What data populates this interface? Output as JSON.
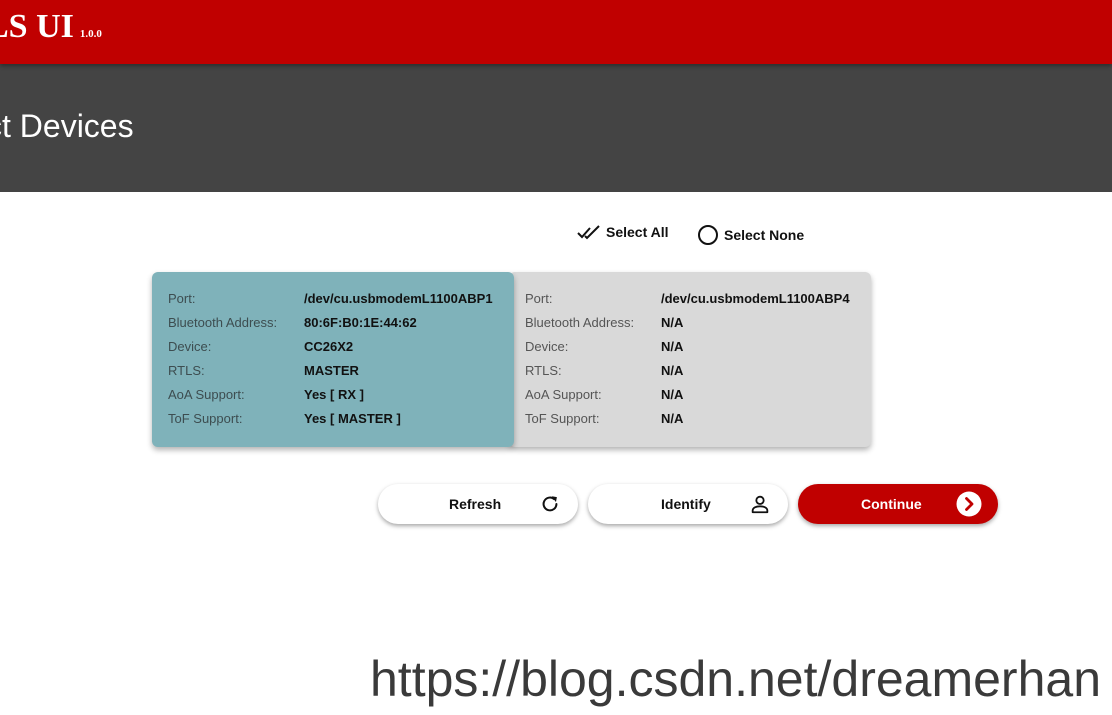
{
  "app": {
    "title": "LS UI",
    "version": "1.0.0",
    "brand_color": "#c00000"
  },
  "header": {
    "title": "ct Devices",
    "background": "#444444"
  },
  "selection": {
    "select_all_label": "Select All",
    "select_all_icon": "double-check-icon",
    "select_none_label": "Select None",
    "select_none_icon": "empty-circle-icon"
  },
  "devices": [
    {
      "selected": true,
      "highlight_color": "#7fb2ba",
      "fields": [
        {
          "label": "Port:",
          "value": "/dev/cu.usbmodemL1100ABP1"
        },
        {
          "label": "Bluetooth Address:",
          "value": "80:6F:B0:1E:44:62"
        },
        {
          "label": "Device:",
          "value": "CC26X2"
        },
        {
          "label": "RTLS:",
          "value": "MASTER"
        },
        {
          "label": "AoA Support:",
          "value": "Yes [ RX ]"
        },
        {
          "label": "ToF Support:",
          "value": "Yes [ MASTER ]"
        }
      ]
    },
    {
      "selected": false,
      "highlight_color": "#d9d9d9",
      "fields": [
        {
          "label": "Port:",
          "value": "/dev/cu.usbmodemL1100ABP4"
        },
        {
          "label": "Bluetooth Address:",
          "value": "N/A"
        },
        {
          "label": "Device:",
          "value": "N/A"
        },
        {
          "label": "RTLS:",
          "value": "N/A"
        },
        {
          "label": "AoA Support:",
          "value": "N/A"
        },
        {
          "label": "ToF Support:",
          "value": "N/A"
        }
      ]
    }
  ],
  "actions": {
    "refresh_label": "Refresh",
    "refresh_icon": "refresh-icon",
    "identify_label": "Identify",
    "identify_icon": "person-icon",
    "continue_label": "Continue",
    "continue_icon": "chevron-right-icon"
  },
  "watermark": "https://blog.csdn.net/dreamerhan"
}
